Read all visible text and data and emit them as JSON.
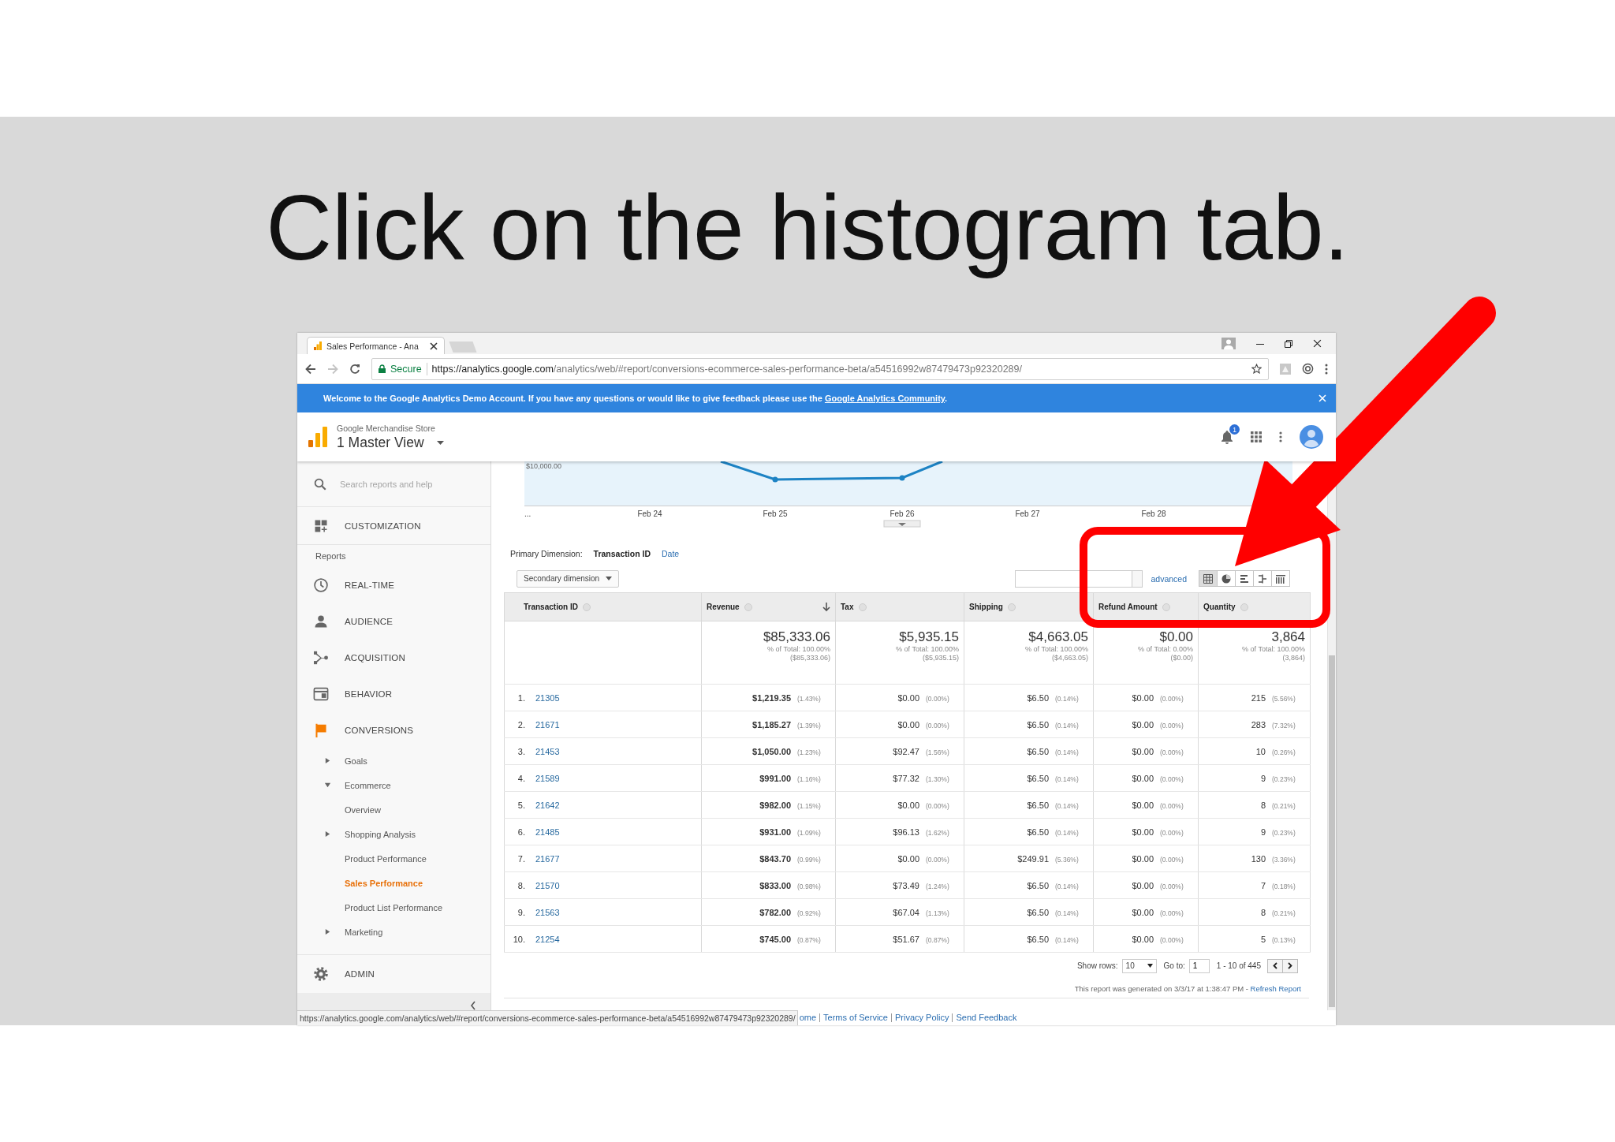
{
  "slide": {
    "title": "Click on the histogram tab."
  },
  "browser": {
    "tab_title": "Sales Performance - Ana",
    "secure_label": "Secure",
    "url_host": "https://analytics.google.com",
    "url_path": "/analytics/web/#report/conversions-ecommerce-sales-performance-beta/a54516992w87479473p92320289/"
  },
  "banner": {
    "text": "Welcome to the Google Analytics Demo Account. If you have any questions or would like to give feedback please use the ",
    "link": "Google Analytics Community",
    "end": "."
  },
  "header": {
    "account": "Google Merchandise Store",
    "view": "1 Master View",
    "notification_count": "1"
  },
  "sidebar": {
    "search_placeholder": "Search reports and help",
    "items": [
      {
        "kind": "section",
        "label": "CUSTOMIZATION",
        "selected": false
      },
      {
        "kind": "heading",
        "label": "Reports"
      },
      {
        "kind": "section",
        "label": "REAL-TIME",
        "selected": false
      },
      {
        "kind": "section",
        "label": "AUDIENCE",
        "selected": false
      },
      {
        "kind": "section",
        "label": "ACQUISITION",
        "selected": false
      },
      {
        "kind": "section",
        "label": "BEHAVIOR",
        "selected": false
      },
      {
        "kind": "section",
        "label": "CONVERSIONS",
        "selected": true,
        "children": [
          {
            "label": "Goals",
            "expanded": false,
            "selected": false
          },
          {
            "label": "Ecommerce",
            "expanded": true,
            "selected": false,
            "children": [
              {
                "label": "Overview",
                "selected": false
              },
              {
                "label": "Shopping Analysis",
                "expanded": false,
                "selected": false
              },
              {
                "label": "Product Performance",
                "selected": false
              },
              {
                "label": "Sales Performance",
                "selected": true
              },
              {
                "label": "Product List Performance",
                "selected": false
              }
            ]
          },
          {
            "label": "Marketing",
            "expanded": false,
            "selected": false
          }
        ]
      }
    ],
    "admin": "ADMIN"
  },
  "chart": {
    "y_tick": "$10,000.00",
    "x_labels": [
      "...",
      "Feb 24",
      "Feb 25",
      "Feb 26",
      "Feb 27",
      "Feb 28"
    ]
  },
  "dimensions": {
    "label": "Primary Dimension:",
    "options": [
      {
        "label": "Transaction ID",
        "selected": true
      },
      {
        "label": "Date",
        "selected": false
      }
    ]
  },
  "toolbar": {
    "secondary_dimension": "Secondary dimension",
    "advanced": "advanced",
    "views": [
      {
        "selected": true
      },
      {
        "selected": false
      },
      {
        "selected": false
      },
      {
        "selected": false
      },
      {
        "selected": false
      }
    ]
  },
  "table": {
    "columns": [
      {
        "label": "Transaction ID",
        "sorted": false
      },
      {
        "label": "Revenue",
        "sorted": true
      },
      {
        "label": "Tax",
        "sorted": false
      },
      {
        "label": "Shipping",
        "sorted": false
      },
      {
        "label": "Refund Amount",
        "sorted": false
      },
      {
        "label": "Quantity",
        "sorted": false
      }
    ],
    "totals": [
      {
        "value": "$85,333.06",
        "share": "% of Total: 100.00%",
        "total": "($85,333.06)"
      },
      {
        "value": "$5,935.15",
        "share": "% of Total: 100.00%",
        "total": "($5,935.15)"
      },
      {
        "value": "$4,663.05",
        "share": "% of Total: 100.00%",
        "total": "($4,663.05)"
      },
      {
        "value": "$0.00",
        "share": "% of Total: 0.00%",
        "total": "($0.00)"
      },
      {
        "value": "3,864",
        "share": "% of Total: 100.00%",
        "total": "(3,864)"
      }
    ],
    "rows": [
      {
        "cells": [
          {
            "rank": "1.",
            "id": "21305"
          },
          {
            "value": "$1,219.35",
            "percent": "(1.43%)"
          },
          {
            "value": "$0.00",
            "percent": "(0.00%)"
          },
          {
            "value": "$6.50",
            "percent": "(0.14%)"
          },
          {
            "value": "$0.00",
            "percent": "(0.00%)"
          },
          {
            "value": "215",
            "percent": "(5.56%)"
          }
        ]
      },
      {
        "cells": [
          {
            "rank": "2.",
            "id": "21671"
          },
          {
            "value": "$1,185.27",
            "percent": "(1.39%)"
          },
          {
            "value": "$0.00",
            "percent": "(0.00%)"
          },
          {
            "value": "$6.50",
            "percent": "(0.14%)"
          },
          {
            "value": "$0.00",
            "percent": "(0.00%)"
          },
          {
            "value": "283",
            "percent": "(7.32%)"
          }
        ]
      },
      {
        "cells": [
          {
            "rank": "3.",
            "id": "21453"
          },
          {
            "value": "$1,050.00",
            "percent": "(1.23%)"
          },
          {
            "value": "$92.47",
            "percent": "(1.56%)"
          },
          {
            "value": "$6.50",
            "percent": "(0.14%)"
          },
          {
            "value": "$0.00",
            "percent": "(0.00%)"
          },
          {
            "value": "10",
            "percent": "(0.26%)"
          }
        ]
      },
      {
        "cells": [
          {
            "rank": "4.",
            "id": "21589"
          },
          {
            "value": "$991.00",
            "percent": "(1.16%)"
          },
          {
            "value": "$77.32",
            "percent": "(1.30%)"
          },
          {
            "value": "$6.50",
            "percent": "(0.14%)"
          },
          {
            "value": "$0.00",
            "percent": "(0.00%)"
          },
          {
            "value": "9",
            "percent": "(0.23%)"
          }
        ]
      },
      {
        "cells": [
          {
            "rank": "5.",
            "id": "21642"
          },
          {
            "value": "$982.00",
            "percent": "(1.15%)"
          },
          {
            "value": "$0.00",
            "percent": "(0.00%)"
          },
          {
            "value": "$6.50",
            "percent": "(0.14%)"
          },
          {
            "value": "$0.00",
            "percent": "(0.00%)"
          },
          {
            "value": "8",
            "percent": "(0.21%)"
          }
        ]
      },
      {
        "cells": [
          {
            "rank": "6.",
            "id": "21485"
          },
          {
            "value": "$931.00",
            "percent": "(1.09%)"
          },
          {
            "value": "$96.13",
            "percent": "(1.62%)"
          },
          {
            "value": "$6.50",
            "percent": "(0.14%)"
          },
          {
            "value": "$0.00",
            "percent": "(0.00%)"
          },
          {
            "value": "9",
            "percent": "(0.23%)"
          }
        ]
      },
      {
        "cells": [
          {
            "rank": "7.",
            "id": "21677"
          },
          {
            "value": "$843.70",
            "percent": "(0.99%)"
          },
          {
            "value": "$0.00",
            "percent": "(0.00%)"
          },
          {
            "value": "$249.91",
            "percent": "(5.36%)"
          },
          {
            "value": "$0.00",
            "percent": "(0.00%)"
          },
          {
            "value": "130",
            "percent": "(3.36%)"
          }
        ]
      },
      {
        "cells": [
          {
            "rank": "8.",
            "id": "21570"
          },
          {
            "value": "$833.00",
            "percent": "(0.98%)"
          },
          {
            "value": "$73.49",
            "percent": "(1.24%)"
          },
          {
            "value": "$6.50",
            "percent": "(0.14%)"
          },
          {
            "value": "$0.00",
            "percent": "(0.00%)"
          },
          {
            "value": "7",
            "percent": "(0.18%)"
          }
        ]
      },
      {
        "cells": [
          {
            "rank": "9.",
            "id": "21563"
          },
          {
            "value": "$782.00",
            "percent": "(0.92%)"
          },
          {
            "value": "$67.04",
            "percent": "(1.13%)"
          },
          {
            "value": "$6.50",
            "percent": "(0.14%)"
          },
          {
            "value": "$0.00",
            "percent": "(0.00%)"
          },
          {
            "value": "8",
            "percent": "(0.21%)"
          }
        ]
      },
      {
        "cells": [
          {
            "rank": "10.",
            "id": "21254"
          },
          {
            "value": "$745.00",
            "percent": "(0.87%)"
          },
          {
            "value": "$51.67",
            "percent": "(0.87%)"
          },
          {
            "value": "$6.50",
            "percent": "(0.14%)"
          },
          {
            "value": "$0.00",
            "percent": "(0.00%)"
          },
          {
            "value": "5",
            "percent": "(0.13%)"
          }
        ]
      }
    ]
  },
  "pagination": {
    "show_rows_label": "Show rows:",
    "rows_value": "10",
    "goto_label": "Go to:",
    "goto_value": "1",
    "range": "1 - 10 of 445"
  },
  "report_note": {
    "text": "This report was generated on 3/3/17 at 1:38:47 PM - ",
    "link": "Refresh Report"
  },
  "footer_links": [
    "ome",
    "Terms of Service",
    "Privacy Policy",
    "Send Feedback"
  ],
  "status_url": "https://analytics.google.com/analytics/web/#report/conversions-ecommerce-sales-performance-beta/a54516992w87479473p92320289/"
}
